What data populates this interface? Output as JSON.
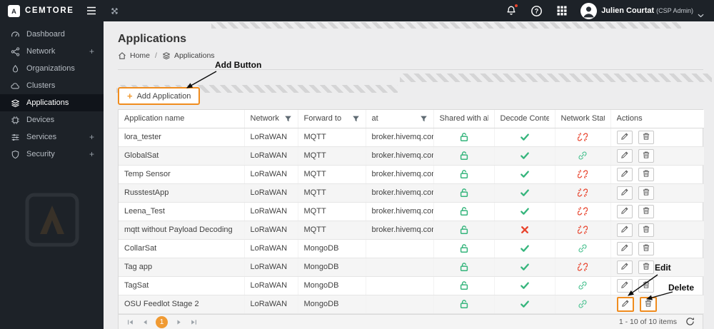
{
  "topbar": {
    "brand": "CEMTORE",
    "user_name": "Julien Courtat",
    "user_role": "(CSP Admin)"
  },
  "sidebar": {
    "expand_glyph": "+",
    "items": [
      {
        "label": "Dashboard",
        "icon": "gauge-icon",
        "expandable": false,
        "active": false
      },
      {
        "label": "Network",
        "icon": "network-icon",
        "expandable": true,
        "active": false
      },
      {
        "label": "Organizations",
        "icon": "organizations-icon",
        "expandable": false,
        "active": false
      },
      {
        "label": "Clusters",
        "icon": "clusters-icon",
        "expandable": false,
        "active": false
      },
      {
        "label": "Applications",
        "icon": "applications-icon",
        "expandable": false,
        "active": true
      },
      {
        "label": "Devices",
        "icon": "devices-icon",
        "expandable": false,
        "active": false
      },
      {
        "label": "Services",
        "icon": "services-icon",
        "expandable": true,
        "active": false
      },
      {
        "label": "Security",
        "icon": "security-icon",
        "expandable": true,
        "active": false
      }
    ]
  },
  "page": {
    "title": "Applications",
    "breadcrumb_home": "Home",
    "breadcrumb_current": "Applications",
    "add_button_plus": "+",
    "add_button_label": "Add Application"
  },
  "table": {
    "columns": [
      {
        "label": "Application name",
        "filter": false
      },
      {
        "label": "Network",
        "filter": true
      },
      {
        "label": "Forward to",
        "filter": true
      },
      {
        "label": "at",
        "filter": true
      },
      {
        "label": "Shared with all",
        "filter": false
      },
      {
        "label": "Decode Content",
        "filter": false
      },
      {
        "label": "Network Status",
        "filter": false
      },
      {
        "label": "Actions",
        "filter": false
      }
    ],
    "rows": [
      {
        "name": "lora_tester",
        "network": "LoRaWAN",
        "forward_to": "MQTT",
        "at": "broker.hivemq.com",
        "shared_icon": "lock-icon",
        "decode_icon": "check-icon",
        "status_icon": "broken-link-icon",
        "highlight_actions": false
      },
      {
        "name": "GlobalSat",
        "network": "LoRaWAN",
        "forward_to": "MQTT",
        "at": "broker.hivemq.com",
        "shared_icon": "lock-icon",
        "decode_icon": "check-icon",
        "status_icon": "link-icon",
        "highlight_actions": false
      },
      {
        "name": "Temp Sensor",
        "network": "LoRaWAN",
        "forward_to": "MQTT",
        "at": "broker.hivemq.com",
        "shared_icon": "lock-icon",
        "decode_icon": "check-icon",
        "status_icon": "broken-link-icon",
        "highlight_actions": false
      },
      {
        "name": "RusstestApp",
        "network": "LoRaWAN",
        "forward_to": "MQTT",
        "at": "broker.hivemq.com",
        "shared_icon": "lock-icon",
        "decode_icon": "check-icon",
        "status_icon": "broken-link-icon",
        "highlight_actions": false
      },
      {
        "name": "Leena_Test",
        "network": "LoRaWAN",
        "forward_to": "MQTT",
        "at": "broker.hivemq.com",
        "shared_icon": "lock-icon",
        "decode_icon": "check-icon",
        "status_icon": "broken-link-icon",
        "highlight_actions": false
      },
      {
        "name": "mqtt without Payload Decoding",
        "network": "LoRaWAN",
        "forward_to": "MQTT",
        "at": "broker.hivemq.com",
        "shared_icon": "lock-icon",
        "decode_icon": "x-icon",
        "status_icon": "broken-link-icon",
        "highlight_actions": false
      },
      {
        "name": "CollarSat",
        "network": "LoRaWAN",
        "forward_to": "MongoDB",
        "at": "",
        "shared_icon": "lock-icon",
        "decode_icon": "check-icon",
        "status_icon": "link-icon",
        "highlight_actions": false
      },
      {
        "name": "Tag app",
        "network": "LoRaWAN",
        "forward_to": "MongoDB",
        "at": "",
        "shared_icon": "lock-icon",
        "decode_icon": "check-icon",
        "status_icon": "broken-link-icon",
        "highlight_actions": false
      },
      {
        "name": "TagSat",
        "network": "LoRaWAN",
        "forward_to": "MongoDB",
        "at": "",
        "shared_icon": "lock-icon",
        "decode_icon": "check-icon",
        "status_icon": "link-icon",
        "highlight_actions": false
      },
      {
        "name": "OSU Feedlot Stage 2",
        "network": "LoRaWAN",
        "forward_to": "MongoDB",
        "at": "",
        "shared_icon": "lock-icon",
        "decode_icon": "check-icon",
        "status_icon": "link-icon",
        "highlight_actions": true
      }
    ]
  },
  "pager": {
    "page": "1",
    "info": "1 - 10 of 10 items"
  },
  "annotations": {
    "add_label": "Add Button",
    "edit_label": "Edit",
    "delete_label": "Delete"
  },
  "colors": {
    "accent": "#f09a32",
    "annotation_orange": "#f08c1e",
    "green": "#35b57c",
    "green_light": "#5cc79b",
    "red": "#e8432c",
    "topbar_bg": "#1d2228"
  }
}
